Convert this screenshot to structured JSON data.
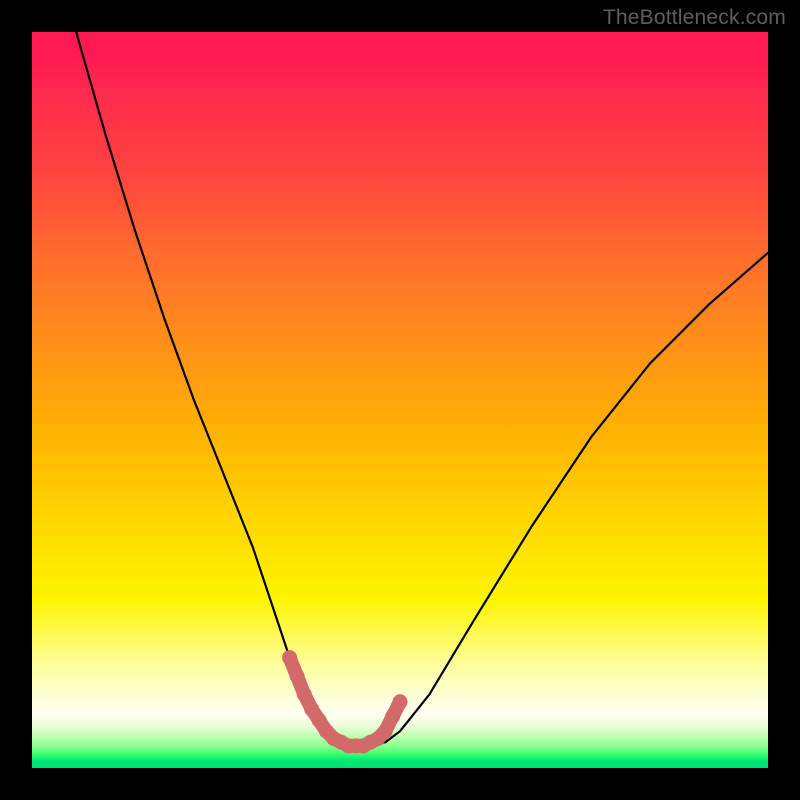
{
  "watermark": "TheBottleneck.com",
  "chart_data": {
    "type": "line",
    "title": "",
    "xlabel": "",
    "ylabel": "",
    "xlim": [
      0,
      100
    ],
    "ylim": [
      0,
      100
    ],
    "grid": false,
    "series": [
      {
        "name": "bottleneck-curve",
        "x": [
          6,
          10,
          14,
          18,
          22,
          26,
          30,
          33,
          35,
          37,
          38.5,
          40,
          42,
          44,
          46,
          48,
          50,
          54,
          60,
          68,
          76,
          84,
          92,
          100
        ],
        "values": [
          100,
          86,
          73,
          61,
          50,
          40,
          30,
          21,
          15,
          10,
          7,
          5,
          3.5,
          3,
          3,
          3.5,
          5,
          10,
          20,
          33,
          45,
          55,
          63,
          70
        ]
      },
      {
        "name": "highlight-segment",
        "x": [
          35,
          36,
          37,
          38,
          39,
          40,
          41,
          42,
          43,
          44,
          45,
          46,
          47,
          48,
          49,
          50
        ],
        "values": [
          15,
          12.5,
          10,
          8,
          6.5,
          5,
          4,
          3.5,
          3,
          3,
          3,
          3.5,
          4,
          5,
          7,
          9
        ]
      }
    ],
    "colors": {
      "curve": "#000000",
      "highlight": "#d36a6a",
      "background_top": "#ff1a52",
      "background_mid": "#ffd800",
      "background_bottom": "#00e070"
    }
  }
}
